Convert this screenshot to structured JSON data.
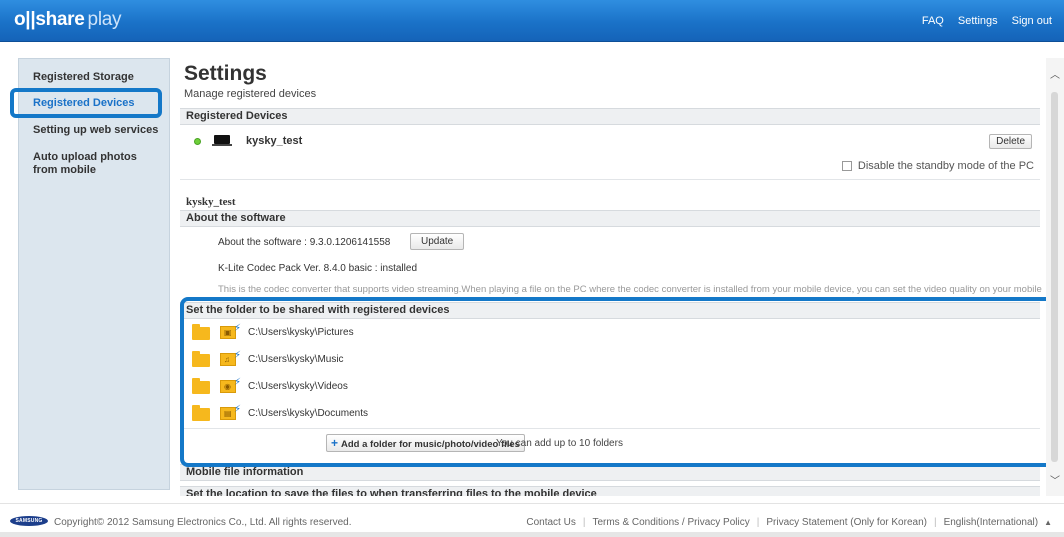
{
  "header": {
    "logo_main": "o||share",
    "logo_sub": "play",
    "links": [
      "FAQ",
      "Settings",
      "Sign out"
    ]
  },
  "sidebar": {
    "items": [
      {
        "label": "Registered Storage"
      },
      {
        "label": "Registered Devices",
        "active": true
      },
      {
        "label": "Setting up web services"
      },
      {
        "label": "Auto upload photos from mobile"
      }
    ]
  },
  "main": {
    "title": "Settings",
    "subtitle": "Manage registered devices",
    "registered_devices": {
      "heading": "Registered Devices",
      "device_name": "kysky_test",
      "delete_label": "Delete",
      "standby_label": "Disable the standby mode of the PC"
    },
    "device_label": "kysky_test",
    "about": {
      "heading": "About the software",
      "version_text": "About the software : 9.3.0.1206141558",
      "update_label": "Update",
      "codec_text": "K-Lite Codec Pack Ver. 8.4.0 basic : installed",
      "codec_desc": "This is the codec converter that supports video streaming.When playing a file on the PC where the codec converter is installed from your mobile device, you can set the video quality on your mobile device"
    },
    "shared_folders": {
      "heading": "Set the folder to be shared with registered devices",
      "folders": [
        {
          "path": "C:\\Users\\kysky\\Pictures",
          "type": "picture"
        },
        {
          "path": "C:\\Users\\kysky\\Music",
          "type": "music"
        },
        {
          "path": "C:\\Users\\kysky\\Videos",
          "type": "video"
        },
        {
          "path": "C:\\Users\\kysky\\Documents",
          "type": "document"
        }
      ],
      "add_label": "Add a folder for music/photo/video files",
      "add_note": "You can add up to 10 folders"
    },
    "mobile_heading": "Mobile file information",
    "next_heading": "Set the location to save the files to when transferring files to the mobile device"
  },
  "footer": {
    "samsung": "SAMSUNG",
    "copyright": "Copyright© 2012 Samsung Electronics Co., Ltd. All rights reserved.",
    "links": [
      "Contact Us",
      "Terms & Conditions / Privacy Policy",
      "Privacy Statement (Only for Korean)",
      "English(International)"
    ]
  },
  "colors": {
    "header_blue": "#1a72c8",
    "highlight_blue": "#1478c8",
    "folder_yellow": "#f6b81d",
    "status_green": "#6ecf3a"
  }
}
